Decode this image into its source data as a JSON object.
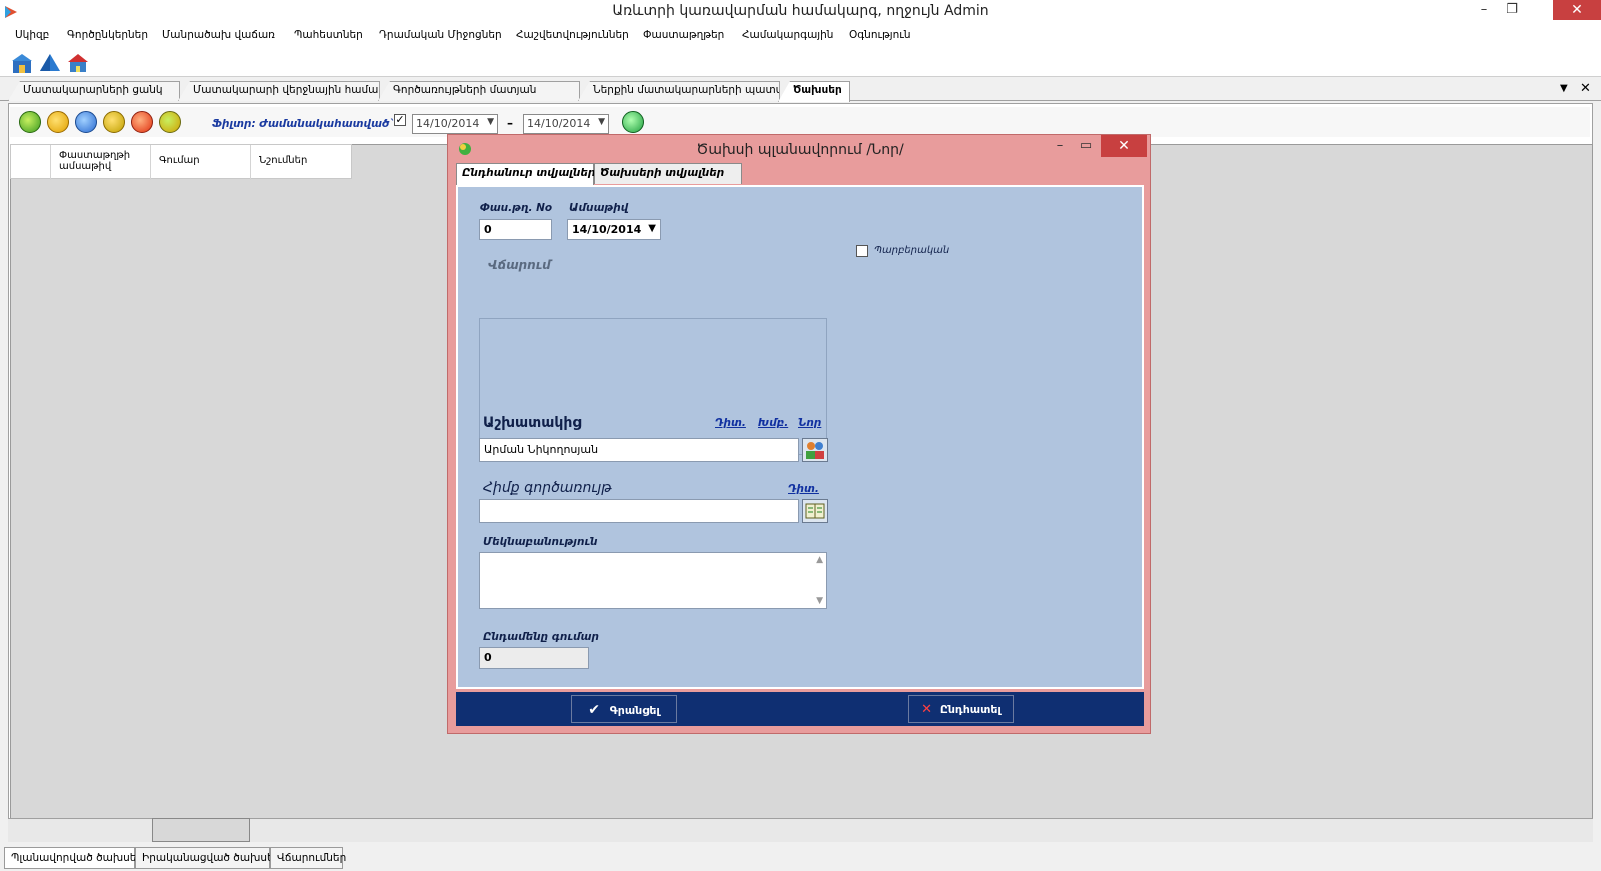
{
  "window": {
    "title": "Առևտրի կառավարման համակարգ, ողջույն Admin"
  },
  "menu": [
    "Սկիզբ",
    "Գործընկերներ",
    "Մանրածախ վաճառ",
    "Պահեստներ",
    "Դրամական Միջոցներ",
    "Հաշվետվություններ",
    "Փաստաթղթեր",
    "Համակարգային",
    "Օգնություն"
  ],
  "doc_tabs": [
    {
      "label": "Մատակարարների ցանկ",
      "active": false
    },
    {
      "label": "Մատակարարի վերջնային համակ...",
      "active": false
    },
    {
      "label": "Գործառույթների մատյան",
      "active": false
    },
    {
      "label": "Ներքին մատակարարների պատվ...",
      "active": false
    },
    {
      "label": "Ծախսեր",
      "active": true
    }
  ],
  "filter": {
    "label": "Ֆիլտր: Ժամանակահատված`",
    "checked": true,
    "date_from": "14/10/2014",
    "separator": "–",
    "date_to": "14/10/2014"
  },
  "grid": {
    "columns": [
      "Փաստաթղթի ամսաթիվ",
      "Գումար",
      "Նշումներ"
    ]
  },
  "bottom_tabs": [
    {
      "label": "Պլանավորված ծախսեր",
      "active": true
    },
    {
      "label": "Իրականացված ծախսեր",
      "active": false
    },
    {
      "label": "Վճարումներ",
      "active": false
    }
  ],
  "dialog": {
    "title": "Ծախսի պլանավորում /Նոր/",
    "tabs": [
      {
        "label": "Ընդհանուր տվյալներ",
        "active": true
      },
      {
        "label": "Ծախսերի տվյալներ",
        "active": false
      }
    ],
    "doc_no_label": "Փաս.թղ. No",
    "doc_no_value": "0",
    "date_label": "Ամսաթիվ",
    "date_value": "14/10/2014",
    "periodic_label": "Պարբերական",
    "payment_group_label": "Վճարում",
    "employee_label": "Աշխատակից",
    "employee_links": [
      "Դիտ.",
      "Խմբ.",
      "Նոր"
    ],
    "employee_value": "Արման Նիկողոսյան",
    "account_label": "Հիմք գործառույթ",
    "account_link": "Դիտ.",
    "account_value": "",
    "comment_label": "Մեկնաբանություն",
    "comment_value": "",
    "total_label": "Ընդամենը գումար",
    "total_value": "0",
    "save_label": "Գրանցել",
    "cancel_label": "Ընդհատել"
  }
}
